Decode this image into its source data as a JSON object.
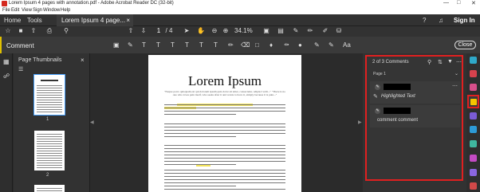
{
  "window": {
    "title": "Lorem Ipsum 4 pages with annotation.pdf - Adobe Acrobat Reader DC (32-bit)",
    "controls": [
      "—",
      "□",
      "✕"
    ]
  },
  "menu": [
    "File",
    "Edit",
    "View",
    "Sign",
    "Window",
    "Help"
  ],
  "nav": {
    "home": "Home",
    "tools": "Tools",
    "doc_tab": "Lorem Ipsum 4 page...",
    "doc_tab_close": "×",
    "sign_in": "Sign In"
  },
  "toolbar": {
    "page_current": "1",
    "page_total": "/ 4",
    "zoom": "34.1%"
  },
  "comment_bar": {
    "label": "Comment",
    "close": "Close"
  },
  "thumbnails": {
    "header": "Page Thumbnails",
    "close": "×",
    "pages": [
      "1",
      "2"
    ]
  },
  "document": {
    "heading": "Lorem Ipsum",
    "subtitle": "\"Neque porro quisquam est qui dolorem ipsum quia dolor sit amet, consectetur, adipisci velit...\" \"There is no one who loves pain itself, who seeks after it and wants to have it, simply because it is pain...\""
  },
  "comments": {
    "count": "2 of 3 Comments",
    "page_group": "Page 1",
    "items": [
      {
        "type": "Highlighted Text",
        "body": "Highlighted Text"
      },
      {
        "type": "comment",
        "body": "comment comment"
      }
    ]
  },
  "colors": {
    "accent_red": "#e02020",
    "highlight": "#f3e35a",
    "comment_tool": "#f5c400"
  }
}
